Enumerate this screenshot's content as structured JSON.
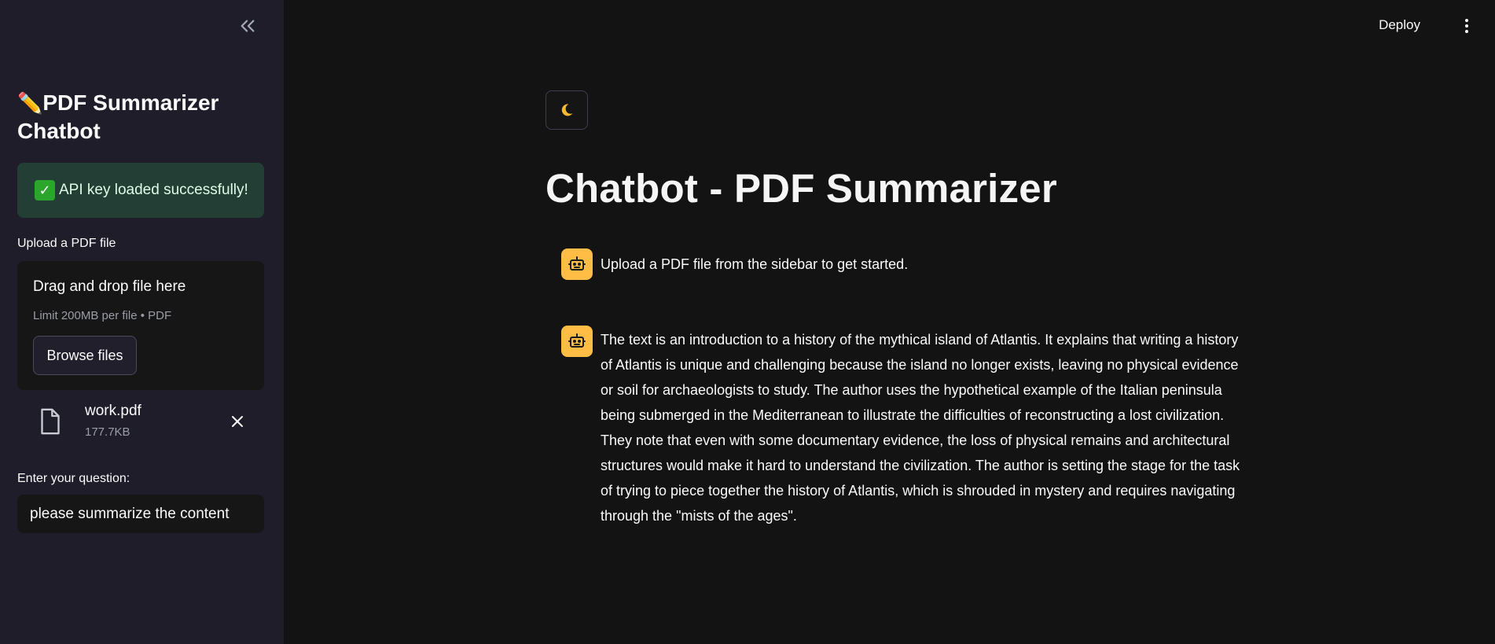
{
  "sidebar": {
    "collapse_label": "«",
    "title_emoji": "✏️",
    "title": "PDF Summarizer Chatbot",
    "success": {
      "icon": "check-icon",
      "text": "API key loaded successfully!"
    },
    "upload_label": "Upload a PDF file",
    "dropzone": {
      "title": "Drag and drop file here",
      "limit": "Limit 200MB per file • PDF",
      "browse_label": "Browse files"
    },
    "file": {
      "name": "work.pdf",
      "size": "177.7KB"
    },
    "question_label": "Enter your question:",
    "question_value": "please summarize the content"
  },
  "header": {
    "deploy_label": "Deploy"
  },
  "main": {
    "title": "Chatbot - PDF Summarizer",
    "messages": [
      {
        "role": "assistant",
        "text": "Upload a PDF file from the sidebar to get started."
      },
      {
        "role": "assistant",
        "text": "The text is an introduction to a history of the mythical island of Atlantis. It explains that writing a history of Atlantis is unique and challenging because the island no longer exists, leaving no physical evidence or soil for archaeologists to study. The author uses the hypothetical example of the Italian peninsula being submerged in the Mediterranean to illustrate the difficulties of reconstructing a lost civilization. They note that even with some documentary evidence, the loss of physical remains and architectural structures would make it hard to understand the civilization. The author is setting the stage for the task of trying to piece together the history of Atlantis, which is shrouded in mystery and requires navigating through the \"mists of the ages\"."
      }
    ]
  },
  "colors": {
    "sidebar_bg": "#1f1d2a",
    "main_bg": "#131313",
    "success_bg": "#233f35",
    "avatar_bg": "#ffbd45",
    "text": "#fafafa"
  }
}
